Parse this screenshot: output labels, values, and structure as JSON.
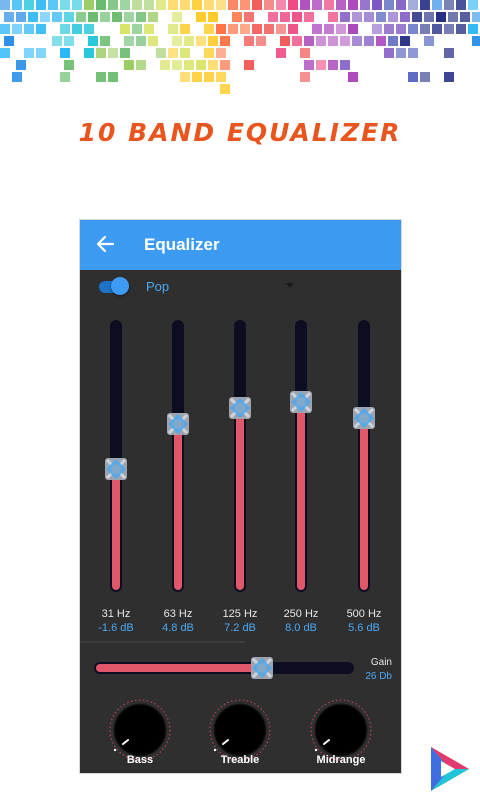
{
  "promo": {
    "headline": "10 BAND EQUALIZER"
  },
  "appbar": {
    "title": "Equalizer",
    "back_icon": "arrow-left-icon"
  },
  "toolbar": {
    "preset": "Pop",
    "enabled": true
  },
  "bands": [
    {
      "freq": "31 Hz",
      "gain": "-1.6 dB",
      "level": 0.45
    },
    {
      "freq": "63 Hz",
      "gain": "4.8 dB",
      "level": 0.62
    },
    {
      "freq": "125 Hz",
      "gain": "7.2 dB",
      "level": 0.68
    },
    {
      "freq": "250 Hz",
      "gain": "8.0 dB",
      "level": 0.7
    },
    {
      "freq": "500 Hz",
      "gain": "5.6 dB",
      "level": 0.64
    }
  ],
  "master": {
    "label": "Gain",
    "value": "26 Db",
    "level": 0.65
  },
  "knobs": [
    {
      "label": "Bass"
    },
    {
      "label": "Treable"
    },
    {
      "label": "Midrange"
    }
  ],
  "colors": {
    "accent": "#3c9af0",
    "fill": "#e0576a",
    "track": "#0d0d22",
    "panel": "#2f2f2f",
    "headline": "#e8551e"
  }
}
